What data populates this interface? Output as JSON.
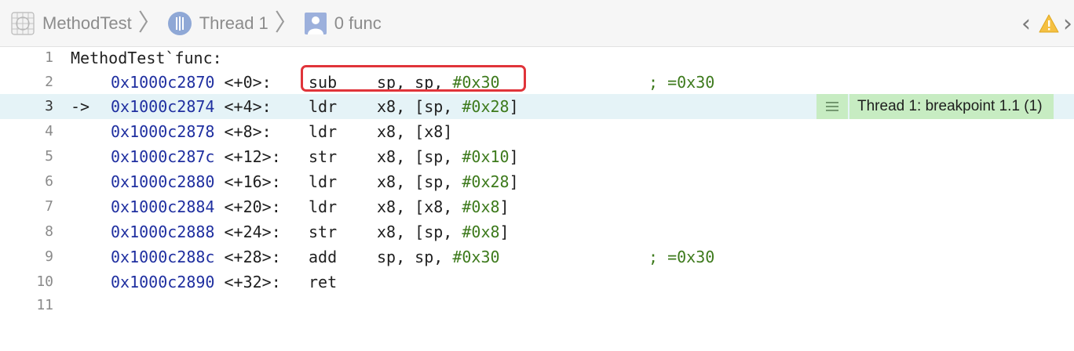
{
  "jumpbar": {
    "crumbs": [
      {
        "label": "MethodTest",
        "icon": "project-grid-icon"
      },
      {
        "label": "Thread 1",
        "icon": "thread-icon"
      },
      {
        "label": "0 func",
        "icon": "stack-frame-icon"
      }
    ],
    "separator": "〉",
    "back_arrow": "‹",
    "warning_icon": "warning-triangle-icon",
    "colors": {
      "warning": "#f5c042"
    }
  },
  "editor": {
    "current_line_marker": "->",
    "lines": [
      {
        "num": "1",
        "text": "MethodTest`func:"
      },
      {
        "num": "2",
        "addr": "0x1000c2870",
        "offset": "<+0>:",
        "mnemonic": "sub",
        "ops_pre": "sp, sp, ",
        "ops_num": "#0x30",
        "ops_post": "",
        "comment": "; =0x30"
      },
      {
        "num": "3",
        "addr": "0x1000c2874",
        "offset": "<+4>:",
        "mnemonic": "ldr",
        "ops_pre": "x8, [sp, ",
        "ops_num": "#0x28",
        "ops_post": "]",
        "comment": ""
      },
      {
        "num": "4",
        "addr": "0x1000c2878",
        "offset": "<+8>:",
        "mnemonic": "ldr",
        "ops_pre": "x8, [x8]",
        "ops_num": "",
        "ops_post": "",
        "comment": ""
      },
      {
        "num": "5",
        "addr": "0x1000c287c",
        "offset": "<+12>:",
        "mnemonic": "str",
        "ops_pre": "x8, [sp, ",
        "ops_num": "#0x10",
        "ops_post": "]",
        "comment": ""
      },
      {
        "num": "6",
        "addr": "0x1000c2880",
        "offset": "<+16>:",
        "mnemonic": "ldr",
        "ops_pre": "x8, [sp, ",
        "ops_num": "#0x28",
        "ops_post": "]",
        "comment": ""
      },
      {
        "num": "7",
        "addr": "0x1000c2884",
        "offset": "<+20>:",
        "mnemonic": "ldr",
        "ops_pre": "x8, [x8, ",
        "ops_num": "#0x8",
        "ops_post": "]",
        "comment": ""
      },
      {
        "num": "8",
        "addr": "0x1000c2888",
        "offset": "<+24>:",
        "mnemonic": "str",
        "ops_pre": "x8, [sp, ",
        "ops_num": "#0x8",
        "ops_post": "]",
        "comment": ""
      },
      {
        "num": "9",
        "addr": "0x1000c288c",
        "offset": "<+28>:",
        "mnemonic": "add",
        "ops_pre": "sp, sp, ",
        "ops_num": "#0x30",
        "ops_post": "",
        "comment": "; =0x30"
      },
      {
        "num": "10",
        "addr": "0x1000c2890",
        "offset": "<+32>:",
        "mnemonic": "ret",
        "ops_pre": "",
        "ops_num": "",
        "ops_post": "",
        "comment": ""
      },
      {
        "num": "11",
        "text": ""
      }
    ],
    "breakpoint_annotation": {
      "menu_icon": "hamburger-menu-icon",
      "label": "Thread 1: breakpoint 1.1 (1)"
    },
    "colors": {
      "address": "#1f2fa0",
      "immediate": "#3d7a1c",
      "current_line_bg": "#e5f3f7",
      "annotation_bg": "#c7ecc2",
      "highlight_border": "#e0343a"
    }
  }
}
